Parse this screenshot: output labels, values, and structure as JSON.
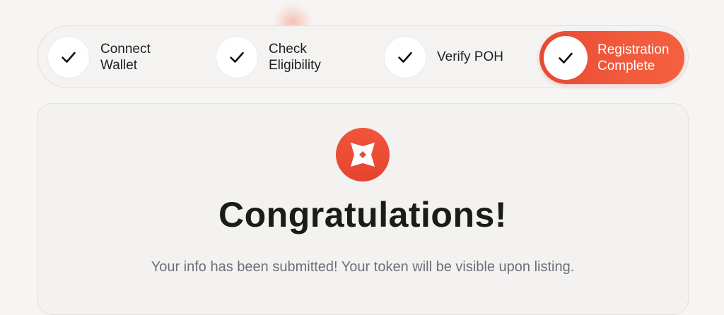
{
  "colors": {
    "accent": "#EF5237",
    "background": "#F6F5F4",
    "title": "#1B1B17",
    "subtitle": "#6E6E78"
  },
  "stepper": {
    "steps": [
      {
        "label": "Connect\nWallet",
        "icon": "check-icon",
        "status": "done"
      },
      {
        "label": "Check\nEligibility",
        "icon": "check-icon",
        "status": "done"
      },
      {
        "label": "Verify POH",
        "icon": "check-icon",
        "status": "done"
      },
      {
        "label": "Registration\nComplete",
        "icon": "check-icon",
        "status": "active"
      }
    ]
  },
  "success": {
    "icon": "brand-logo-icon",
    "title": "Congratulations!",
    "message": "Your info has been submitted! Your token will be visible upon listing."
  }
}
